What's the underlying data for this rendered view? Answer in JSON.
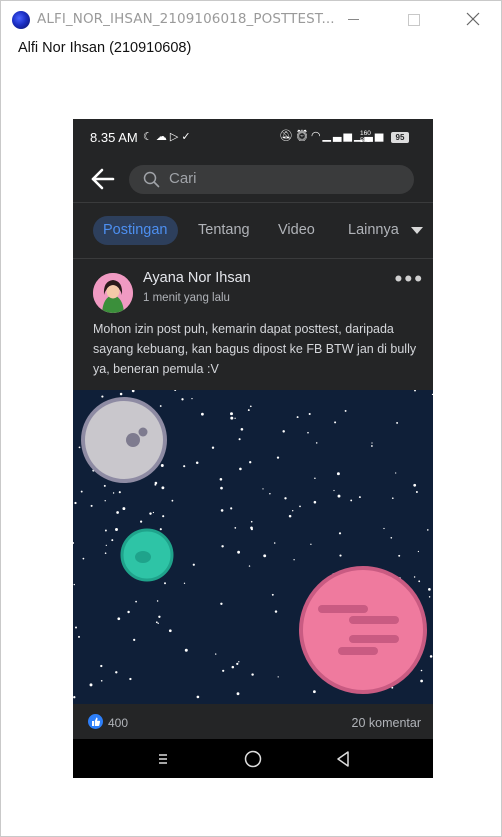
{
  "window": {
    "title": "ALFI_NOR_IHSAN_2109106018_POSTTEST...",
    "label": "Alfi Nor Ihsan (210910608)"
  },
  "phone": {
    "status": {
      "time": "8.35 AM",
      "net_speed_top": "160",
      "net_speed_bottom": "B/S",
      "battery": "95"
    },
    "search": {
      "placeholder": "Cari"
    },
    "tabs": [
      "Postingan",
      "Tentang",
      "Video",
      "Lainnya"
    ],
    "post": {
      "author": "Ayana Nor Ihsan",
      "time": "1 menit yang lalu",
      "menu": "•••",
      "text": "Mohon izin post puh, kemarin dapat posttest, daripada sayang kebuang, kan bagus dipost ke FB BTW jan di bully ya, beneran pemula :V",
      "likes": "400",
      "comments": "20 komentar"
    }
  },
  "colors": {
    "phone_bg": "#242526",
    "space_bg": "#0f1f38",
    "accent_blue": "#2d7ff9",
    "planet_gray": "#c9c7cc",
    "planet_teal": "#2ec4a6",
    "planet_pink": "#ef7a9e"
  },
  "icons": [
    "app-icon",
    "minimize-icon",
    "maximize-icon",
    "close-icon",
    "back-arrow-icon",
    "search-icon",
    "caret-down-icon",
    "more-icon",
    "like-icon",
    "recents-icon",
    "home-icon",
    "back-icon"
  ]
}
